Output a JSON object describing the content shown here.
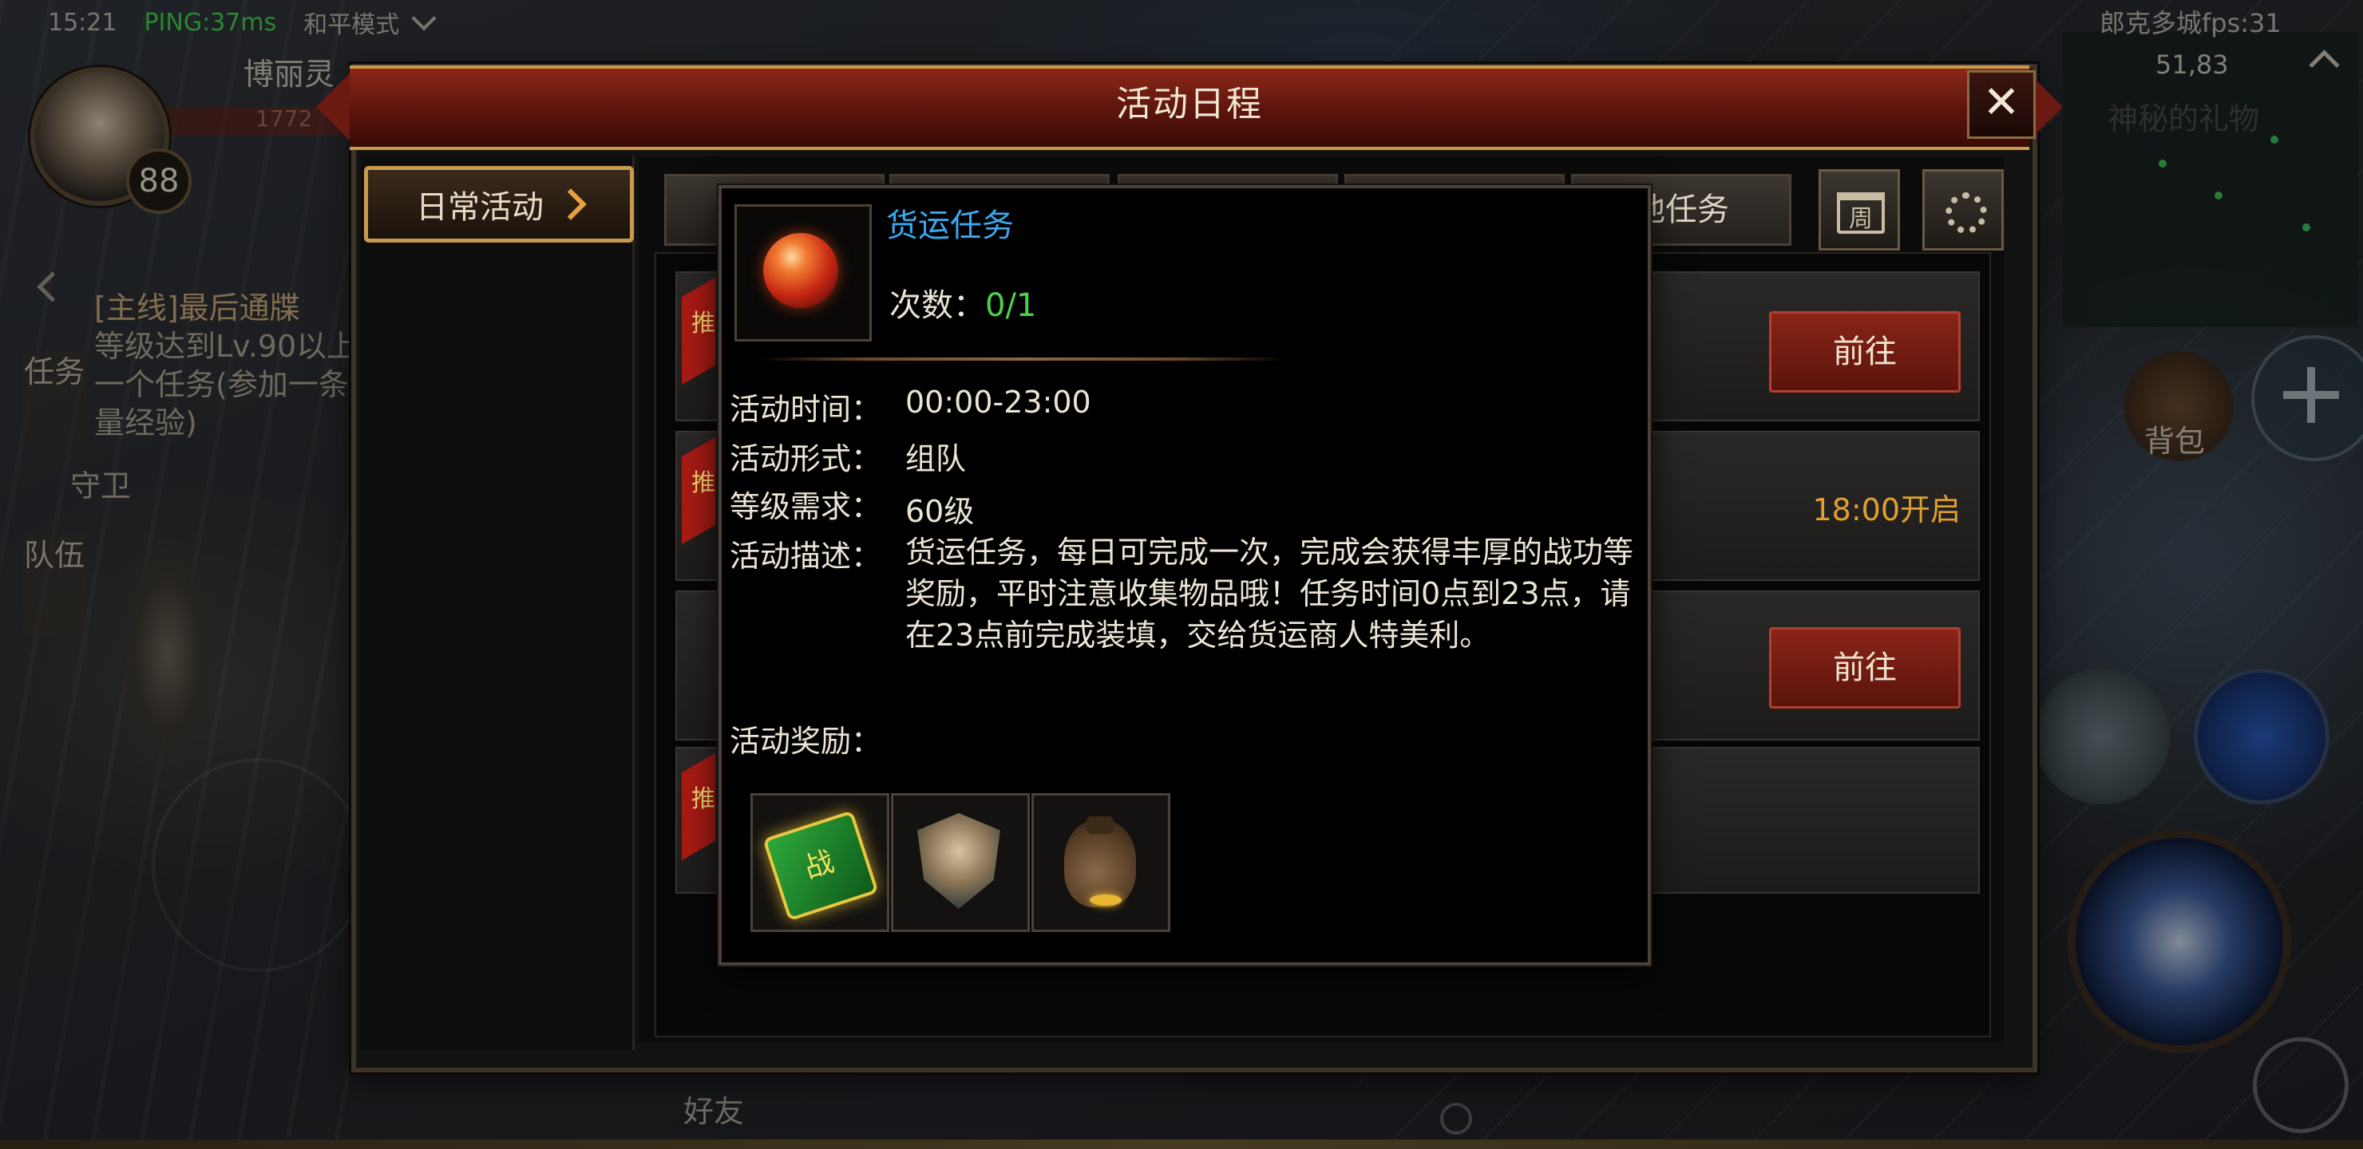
{
  "hud": {
    "time": "15:21",
    "ping": "PING:37ms",
    "mode": "和平模式",
    "player_name": "博丽灵",
    "hp": "1772",
    "level": "88",
    "fps": "郎克多城fps:31",
    "coords": "51,83",
    "minimap_banner": "神秘的礼物",
    "bag_label": "背包",
    "friend_label": "好友"
  },
  "quest_tracker": {
    "tab_task": "任务",
    "tab_team": "队伍",
    "quest_title": "[主线]最后通牒",
    "quest_desc": "等级达到Lv.90以上一个任务(参加一条量经验)",
    "guard": "守卫"
  },
  "window": {
    "title": "活动日程",
    "close_glyph": "✕",
    "nav_daily": "日常活动",
    "tabs": [
      "",
      "",
      "",
      "",
      "他任务"
    ],
    "calendar_glyph": "周",
    "rows": [
      {
        "badge": "推",
        "action": "前往"
      },
      {
        "badge": "推",
        "status": "18:00开启"
      },
      {
        "badge": "",
        "action": "前往"
      },
      {
        "badge": "推"
      }
    ]
  },
  "popup": {
    "item_name": "货运任务",
    "count_label": "次数：",
    "count_value": "0/1",
    "time_label": "活动时间：",
    "time_value": "00:00-23:00",
    "form_label": "活动形式：",
    "form_value": "组队",
    "level_label": "等级需求：",
    "level_value": "60级",
    "desc_label": "活动描述：",
    "desc_value": "货运任务，每日可完成一次，完成会获得丰厚的战功等奖励，平时注意收集物品哦！任务时间0点到23点，请在23点前完成装填，交给货运商人特美利。",
    "reward_label": "活动奖励：",
    "rewards": [
      {
        "icon": "merit-card-icon",
        "glyph": "战"
      },
      {
        "icon": "shield-emblem-icon"
      },
      {
        "icon": "coin-bag-icon"
      }
    ]
  },
  "colors": {
    "title_red": "#8c2818",
    "gold_border": "#c89a50",
    "item_name_blue": "#3aa8f0",
    "count_green": "#4ad24a",
    "status_orange": "#e0a030",
    "ping_green": "#3fcf4a"
  }
}
